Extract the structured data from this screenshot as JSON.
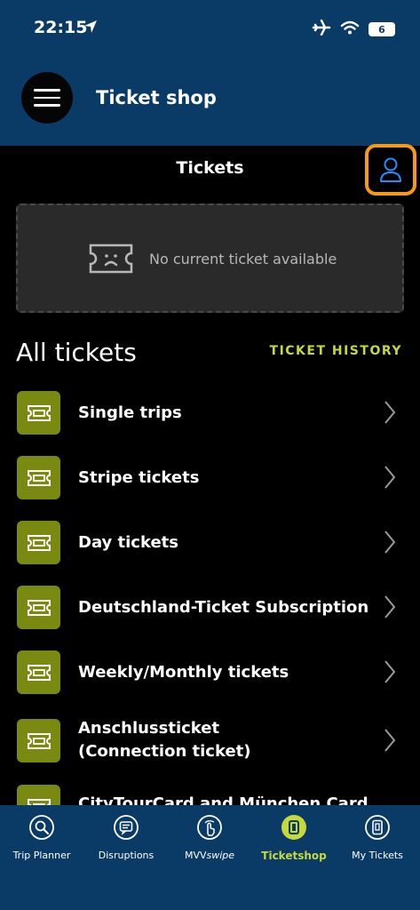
{
  "status": {
    "time": "22:15",
    "battery": "6"
  },
  "header": {
    "title": "Ticket shop"
  },
  "section": {
    "title": "Tickets"
  },
  "empty_state": {
    "text": "No current ticket available"
  },
  "list_header": {
    "title": "All tickets",
    "history_link": "TICKET HISTORY"
  },
  "tickets": [
    {
      "label": "Single trips"
    },
    {
      "label": "Stripe tickets"
    },
    {
      "label": "Day tickets"
    },
    {
      "label": "Deutschland-Ticket Subscription"
    },
    {
      "label": "Weekly/Monthly tickets"
    },
    {
      "label_line1": "Anschlussticket",
      "label_line2": "(Connection ticket)"
    },
    {
      "label": "CityTourCard and München Card"
    }
  ],
  "tabs": [
    {
      "label": "Trip Planner",
      "icon": "search-icon"
    },
    {
      "label": "Disruptions",
      "icon": "disruptions-icon"
    },
    {
      "label_main": "MVV",
      "label_suffix": "swipe",
      "icon": "swipe-icon"
    },
    {
      "label": "Ticketshop",
      "icon": "ticketshop-icon",
      "active": true
    },
    {
      "label": "My Tickets",
      "icon": "my-tickets-icon"
    }
  ],
  "colors": {
    "header_bg": "#0a3b66",
    "accent_green": "#c6d83a",
    "icon_green": "#7a8a10",
    "highlight_orange": "#f59a11",
    "profile_blue": "#1e90ff"
  }
}
